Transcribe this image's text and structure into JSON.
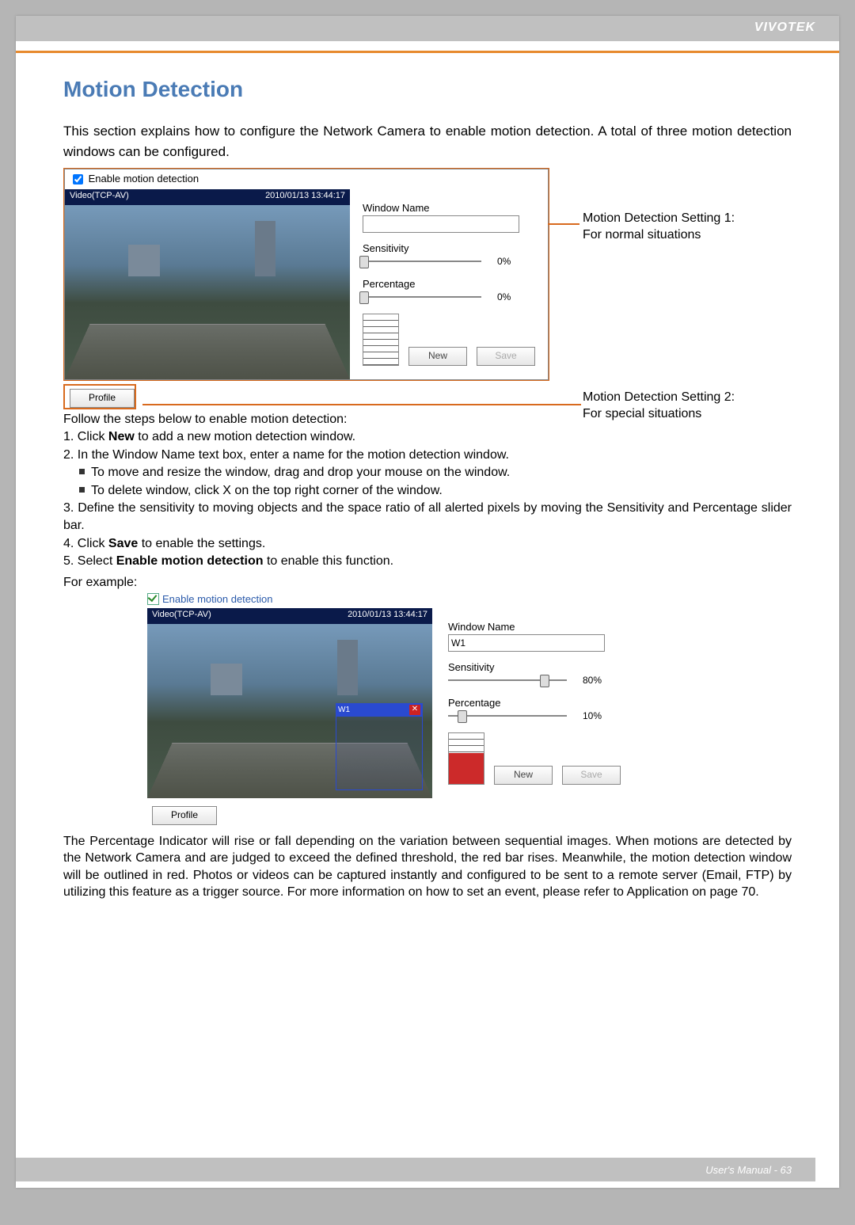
{
  "brand": "VIVOTEK",
  "title": "Motion Detection",
  "intro": "This section explains how to configure the Network Camera to enable motion detection. A total of three motion detection windows can be configured.",
  "panel1": {
    "enable_label": "Enable motion detection",
    "video_source": "Video(TCP-AV)",
    "timestamp": "2010/01/13 13:44:17",
    "window_name_label": "Window Name",
    "window_name_value": "",
    "sensitivity_label": "Sensitivity",
    "sensitivity_value": "0%",
    "percentage_label": "Percentage",
    "percentage_value": "0%",
    "new_btn": "New",
    "save_btn": "Save",
    "profile_btn": "Profile"
  },
  "callout1_line1": "Motion Detection Setting 1:",
  "callout1_line2": "For normal situations",
  "callout2_line1": "Motion Detection Setting 2:",
  "callout2_line2": "For special situations",
  "steps_intro": "Follow the steps below to enable motion detection:",
  "step1": "1. Click New to add a new motion detection window.",
  "step2": "2. In the Window Name text box, enter a name for the motion detection window.",
  "step2a": "To move and resize the window, drag and drop your mouse on the window.",
  "step2b": "To delete window, click X on the top right corner of the window.",
  "step3": "3. Define the sensitivity to moving objects and the space ratio of all alerted pixels by moving the Sensitivity and Percentage slider bar.",
  "step4": "4. Click Save to enable the settings.",
  "step5": "5. Select Enable motion detection to enable this function.",
  "for_example": "For example:",
  "panel2": {
    "enable_label": "Enable motion detection",
    "video_source": "Video(TCP-AV)",
    "timestamp": "2010/01/13 13:44:17",
    "window_name_label": "Window Name",
    "window_name_value": "W1",
    "overlay_title": "W1",
    "sensitivity_label": "Sensitivity",
    "sensitivity_value": "80%",
    "percentage_label": "Percentage",
    "percentage_value": "10%",
    "new_btn": "New",
    "save_btn": "Save",
    "profile_btn": "Profile"
  },
  "footer_para": "The Percentage Indicator will rise or fall depending on the variation between sequential images. When motions are detected by the Network Camera and are judged to exceed the defined threshold, the red bar rises. Meanwhile, the motion detection window will be outlined in red. Photos or videos can be captured instantly and configured to be sent to a remote server (Email, FTP) by utilizing this feature as a trigger source. For more information on how to set an event, please refer to Application on page 70.",
  "page_footer": "User's Manual - 63"
}
